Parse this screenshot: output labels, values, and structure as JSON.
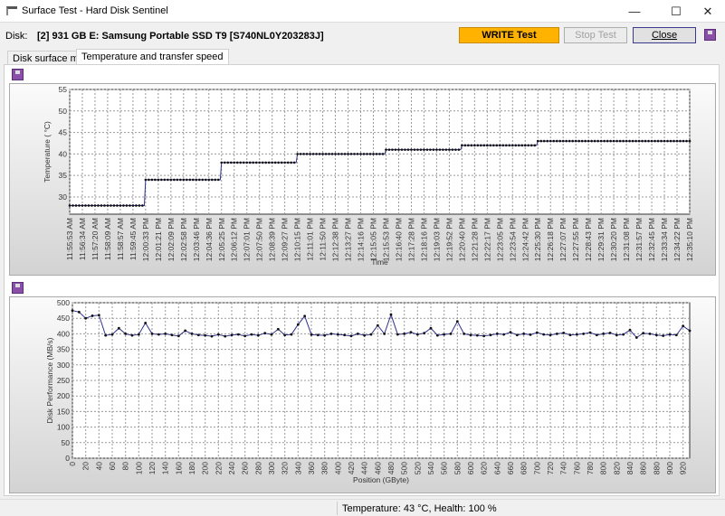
{
  "window": {
    "title": "Surface Test - Hard Disk Sentinel"
  },
  "toolbar": {
    "disk_label": "Disk:",
    "disk_value": "[2] 931 GB E: Samsung Portable SSD T9 [S740NL0Y203283J]",
    "write_test": "WRITE Test",
    "stop_test": "Stop Test",
    "close": "Close"
  },
  "tabs": [
    {
      "label": "Disk surface map"
    },
    {
      "label": "Temperature and transfer speed"
    }
  ],
  "status": {
    "text": "Temperature: 43  °C,  Health: 100 %"
  },
  "chart_data": [
    {
      "type": "line",
      "ylabel": "Temperature ( °C)",
      "xlabel": "Time",
      "ylim": [
        26,
        55
      ],
      "yticks": [
        30,
        35,
        40,
        45,
        50,
        55
      ],
      "categories": [
        "11:55:53 AM",
        "11:56:34 AM",
        "11:57:20 AM",
        "11:58:09 AM",
        "11:58:57 AM",
        "11:59:45 AM",
        "12:00:33 PM",
        "12:01:21 PM",
        "12:02:09 PM",
        "12:02:58 PM",
        "12:03:46 PM",
        "12:04:36 PM",
        "12:05:25 PM",
        "12:06:12 PM",
        "12:07:01 PM",
        "12:07:50 PM",
        "12:08:39 PM",
        "12:09:27 PM",
        "12:10:15 PM",
        "12:11:01 PM",
        "12:11:50 PM",
        "12:12:38 PM",
        "12:13:27 PM",
        "12:14:16 PM",
        "12:15:05 PM",
        "12:15:53 PM",
        "12:16:40 PM",
        "12:17:28 PM",
        "12:18:16 PM",
        "12:19:03 PM",
        "12:19:52 PM",
        "12:20:40 PM",
        "12:21:28 PM",
        "12:22:17 PM",
        "12:23:05 PM",
        "12:23:54 PM",
        "12:24:42 PM",
        "12:25:30 PM",
        "12:26:18 PM",
        "12:27:07 PM",
        "12:27:55 PM",
        "12:28:43 PM",
        "12:29:31 PM",
        "12:30:20 PM",
        "12:31:08 PM",
        "12:31:57 PM",
        "12:32:45 PM",
        "12:33:34 PM",
        "12:34:22 PM",
        "12:35:10 PM"
      ],
      "values": [
        28,
        28,
        28,
        28,
        28,
        28,
        34,
        34,
        34,
        34,
        34,
        34,
        38,
        38,
        38,
        38,
        38,
        38,
        40,
        40,
        40,
        40,
        40,
        40,
        40,
        41,
        41,
        41,
        41,
        41,
        41,
        42,
        42,
        42,
        42,
        42,
        42,
        43,
        43,
        43,
        43,
        43,
        43,
        43,
        43,
        43,
        43,
        43,
        43,
        43
      ]
    },
    {
      "type": "line",
      "ylabel": "Disk Performance (MB/s)",
      "xlabel": "Position (GByte)",
      "ylim": [
        0,
        500
      ],
      "yticks": [
        0,
        50,
        100,
        150,
        200,
        250,
        300,
        350,
        400,
        450,
        500
      ],
      "xlim": [
        0,
        930
      ],
      "xstep": 10,
      "xticks": [
        0,
        20,
        40,
        60,
        80,
        100,
        120,
        140,
        160,
        180,
        200,
        220,
        240,
        260,
        280,
        300,
        320,
        340,
        360,
        380,
        400,
        420,
        440,
        460,
        480,
        500,
        520,
        540,
        560,
        580,
        600,
        620,
        640,
        660,
        680,
        700,
        720,
        740,
        760,
        780,
        800,
        820,
        840,
        860,
        880,
        900,
        920
      ],
      "values": [
        475,
        470,
        450,
        458,
        460,
        395,
        398,
        418,
        400,
        395,
        398,
        435,
        400,
        398,
        400,
        396,
        393,
        410,
        400,
        396,
        395,
        392,
        398,
        392,
        396,
        398,
        393,
        398,
        395,
        402,
        398,
        415,
        396,
        398,
        430,
        457,
        397,
        396,
        395,
        400,
        398,
        396,
        393,
        400,
        395,
        398,
        427,
        400,
        462,
        398,
        400,
        405,
        398,
        402,
        418,
        395,
        398,
        400,
        440,
        400,
        396,
        395,
        393,
        396,
        400,
        398,
        405,
        396,
        400,
        397,
        404,
        398,
        396,
        400,
        403,
        396,
        398,
        400,
        404,
        396,
        400,
        403,
        396,
        398,
        412,
        388,
        402,
        400,
        396,
        394,
        398,
        396,
        425,
        410
      ]
    }
  ]
}
